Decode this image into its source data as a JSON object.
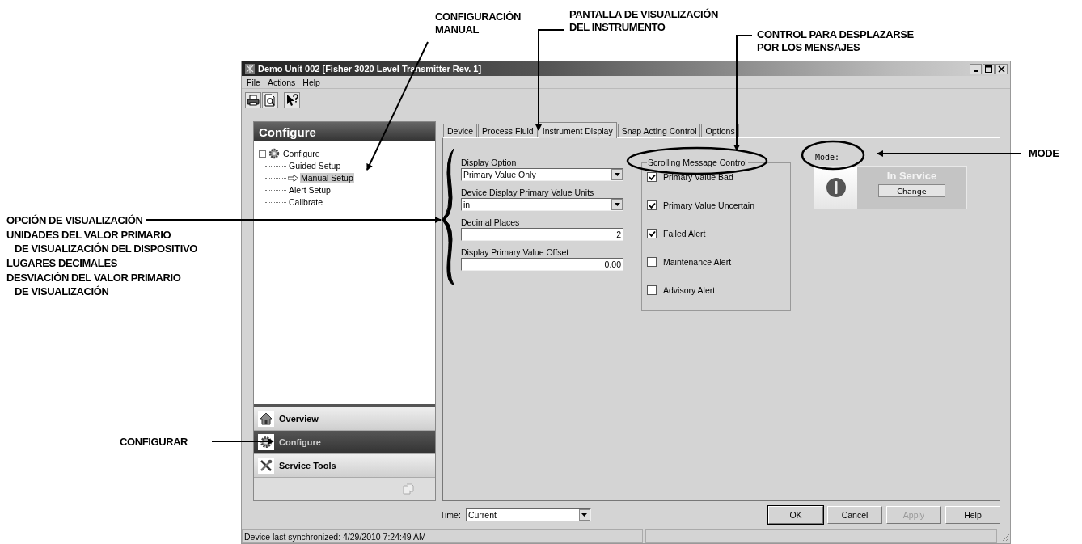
{
  "callouts": [
    {
      "lines": [
        "CONFIGURACIÓN",
        "MANUAL"
      ]
    },
    {
      "lines": [
        "PANTALLA DE VISUALIZACIÓN",
        "DEL INSTRUMENTO"
      ]
    },
    {
      "lines": [
        "CONTROL PARA DESPLAZARSE",
        "POR LOS MENSAJES"
      ]
    },
    {
      "lines": [
        "MODE"
      ]
    },
    {
      "lines": [
        "CONFIGURAR"
      ]
    }
  ],
  "display_callouts": [
    {
      "lines": [
        "OPCIÓN DE VISUALIZACIÓN"
      ]
    },
    {
      "lines": [
        "UNIDADES DEL VALOR PRIMARIO",
        "DE VISUALIZACIÓN DEL DISPOSITIVO"
      ]
    },
    {
      "lines": [
        "LUGARES DECIMALES"
      ]
    },
    {
      "lines": [
        "DESVIACIÓN DEL VALOR PRIMARIO",
        "DE VISUALIZACIÓN"
      ]
    }
  ],
  "window": {
    "title": "Demo Unit 002 [Fisher 3020 Level Transmitter Rev. 1]",
    "menu": [
      "File",
      "Actions",
      "Help"
    ],
    "sidebar": {
      "title": "Configure",
      "tree": {
        "label": "Configure",
        "expanded": true,
        "children": [
          {
            "label": "Guided Setup",
            "selected": false
          },
          {
            "label": "Manual Setup",
            "selected": true
          },
          {
            "label": "Alert Setup",
            "selected": false
          },
          {
            "label": "Calibrate",
            "selected": false
          }
        ]
      },
      "nav": [
        {
          "label": "Overview",
          "kind": "home",
          "selected": false
        },
        {
          "label": "Configure",
          "kind": "gear",
          "selected": true
        },
        {
          "label": "Service Tools",
          "kind": "tools",
          "selected": false
        }
      ]
    },
    "tabs": [
      {
        "label": "Device",
        "selected": false
      },
      {
        "label": "Process Fluid",
        "selected": false
      },
      {
        "label": "Instrument Display",
        "selected": true
      },
      {
        "label": "Snap Acting Control",
        "selected": false
      },
      {
        "label": "Options",
        "selected": false
      }
    ],
    "fields": [
      {
        "label": "Display Option",
        "kind": "select",
        "value": "Primary Value Only"
      },
      {
        "label": "Device Display Primary Value Units",
        "kind": "select",
        "value": "in"
      },
      {
        "label": "Decimal Places",
        "kind": "text",
        "value": "2"
      },
      {
        "label": "Display Primary Value Offset",
        "kind": "text",
        "value": "0.00"
      }
    ],
    "scrolling_group": {
      "title": "Scrolling Message Control",
      "items": [
        {
          "label": "Primary Value Bad",
          "checked": true
        },
        {
          "label": "Primary Value Uncertain",
          "checked": true
        },
        {
          "label": "Failed Alert",
          "checked": true
        },
        {
          "label": "Maintenance Alert",
          "checked": false
        },
        {
          "label": "Advisory Alert",
          "checked": false
        }
      ]
    },
    "mode": {
      "label": "Mode:",
      "status": "In Service",
      "button": "Change"
    },
    "time": {
      "label": "Time:",
      "value": "Current"
    },
    "buttons": [
      {
        "label": "OK",
        "disabled": false
      },
      {
        "label": "Cancel",
        "disabled": false
      },
      {
        "label": "Apply",
        "disabled": true
      },
      {
        "label": "Help",
        "disabled": false
      }
    ],
    "status_bar": "Device last synchronized: 4/29/2010 7:24:49 AM"
  }
}
